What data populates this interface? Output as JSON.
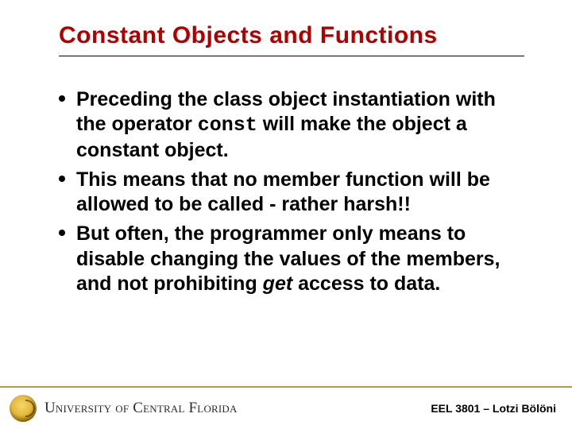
{
  "title": "Constant Objects and Functions",
  "bullets": [
    {
      "pre": "Preceding the class object instantiation with the operator ",
      "code": "const",
      "post": " will make the object a constant object."
    },
    {
      "pre": "This means that no member function will be allowed to be called - rather harsh!!",
      "code": "",
      "post": ""
    },
    {
      "pre": "But often, the programmer only means to disable changing the values of the members, and not prohibiting ",
      "ital": "get",
      "post": " access to data."
    }
  ],
  "footer": {
    "university": "University of Central Florida",
    "course": "EEL 3801 – Lotzi Bölöni"
  }
}
